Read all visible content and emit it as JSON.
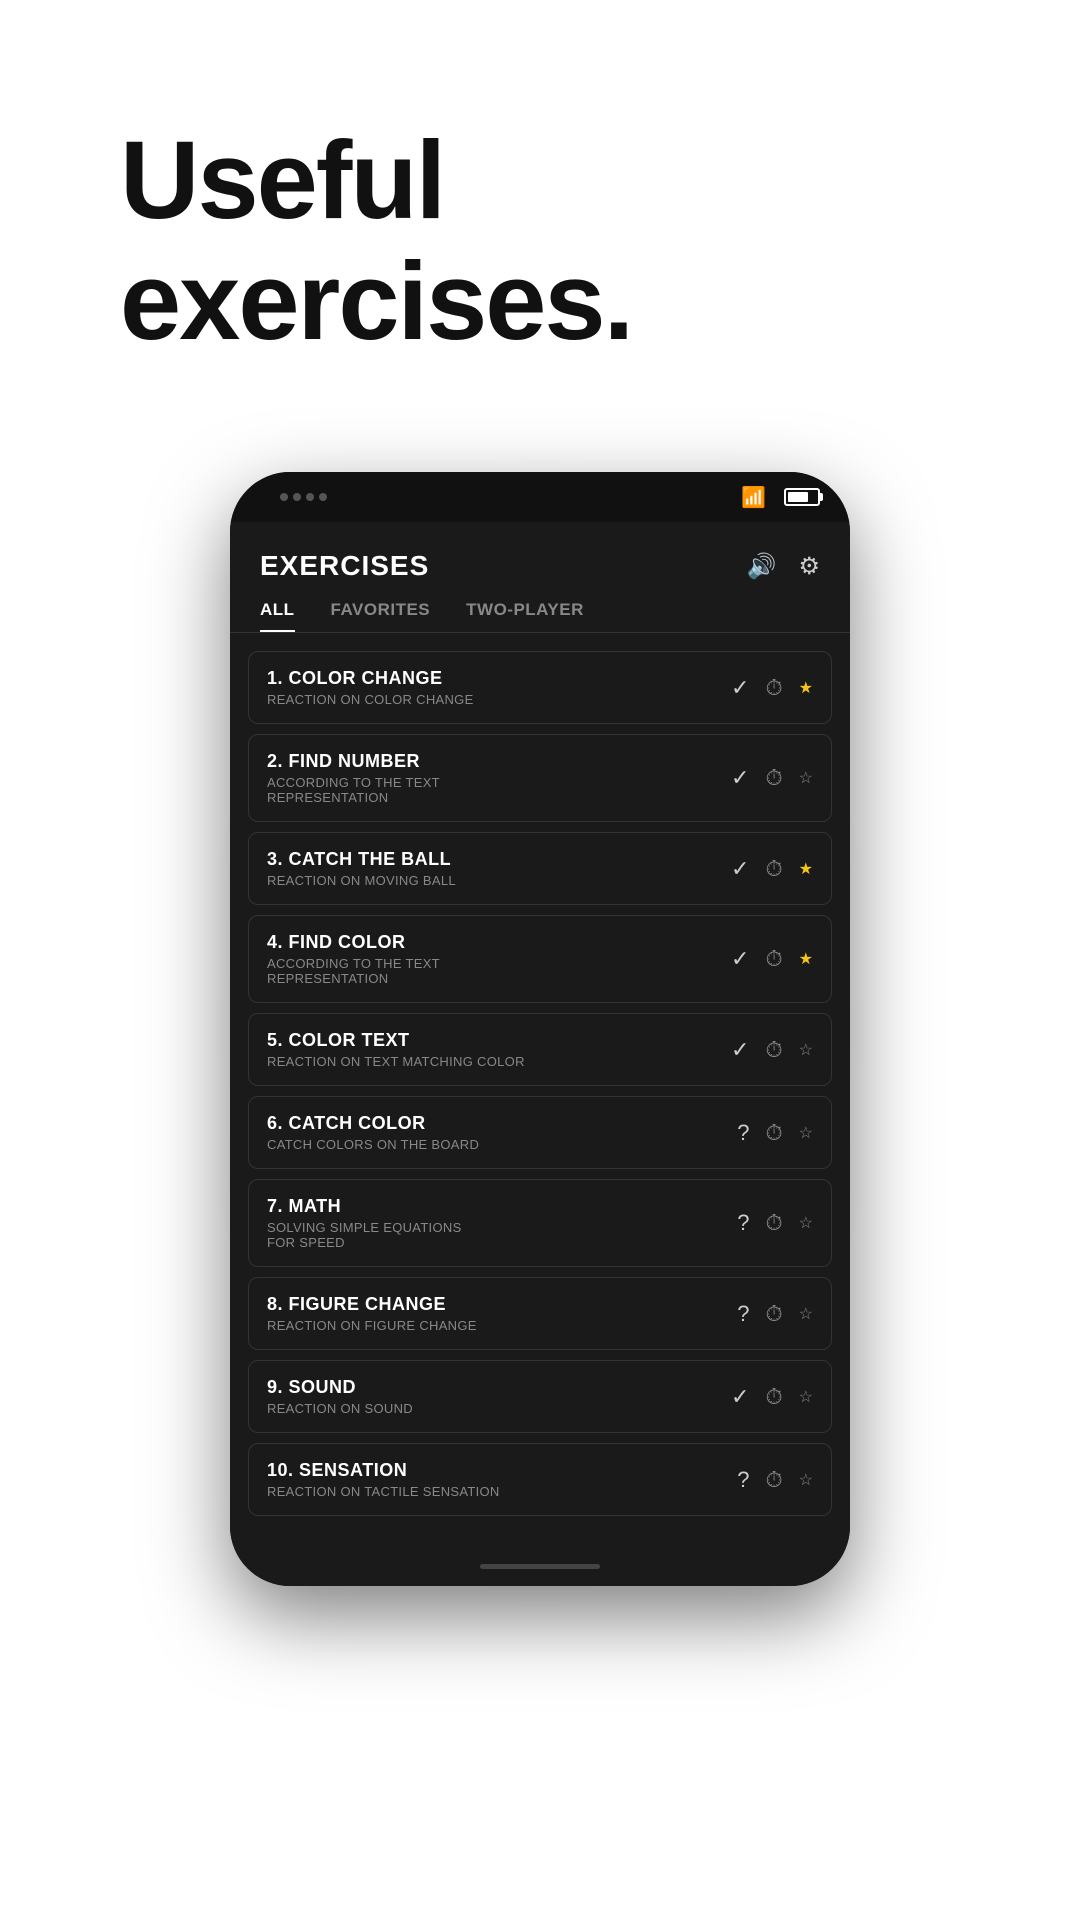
{
  "hero": {
    "title_line1": "Useful",
    "title_line2": "exercises."
  },
  "screen": {
    "title": "EXERCISES",
    "header_icons": {
      "sound": "🔊",
      "settings": "⚙"
    },
    "tabs": [
      {
        "label": "ALL",
        "active": true
      },
      {
        "label": "FAVORITES",
        "active": false
      },
      {
        "label": "TWO-PLAYER",
        "active": false
      }
    ],
    "exercises": [
      {
        "number": "1.",
        "name": "COLOR CHANGE",
        "desc": "REACTION ON COLOR CHANGE",
        "status": "check",
        "starred": true
      },
      {
        "number": "2.",
        "name": "FIND NUMBER",
        "desc": "ACCORDING TO THE TEXT REPRESENTATION",
        "status": "check",
        "starred": false
      },
      {
        "number": "3.",
        "name": "CATCH THE BALL",
        "desc": "REACTION ON MOVING BALL",
        "status": "check",
        "starred": true
      },
      {
        "number": "4.",
        "name": "FIND COLOR",
        "desc": "ACCORDING TO THE TEXT REPRESENTATION",
        "status": "check",
        "starred": true
      },
      {
        "number": "5.",
        "name": "COLOR TEXT",
        "desc": "REACTION ON TEXT MATCHING COLOR",
        "status": "check",
        "starred": false
      },
      {
        "number": "6.",
        "name": "CATCH COLOR",
        "desc": "CATCH COLORS ON THE BOARD",
        "status": "question",
        "starred": false
      },
      {
        "number": "7.",
        "name": "MATH",
        "desc": "SOLVING SIMPLE EQUATIONS FOR SPEED",
        "status": "question",
        "starred": false
      },
      {
        "number": "8.",
        "name": "FIGURE CHANGE",
        "desc": "REACTION ON FIGURE CHANGE",
        "status": "question",
        "starred": false
      },
      {
        "number": "9.",
        "name": "SOUND",
        "desc": "REACTION ON SOUND",
        "status": "check",
        "starred": false
      },
      {
        "number": "10.",
        "name": "SENSATION",
        "desc": "REACTION ON TACTILE SENSATION",
        "status": "question",
        "starred": false
      }
    ]
  }
}
